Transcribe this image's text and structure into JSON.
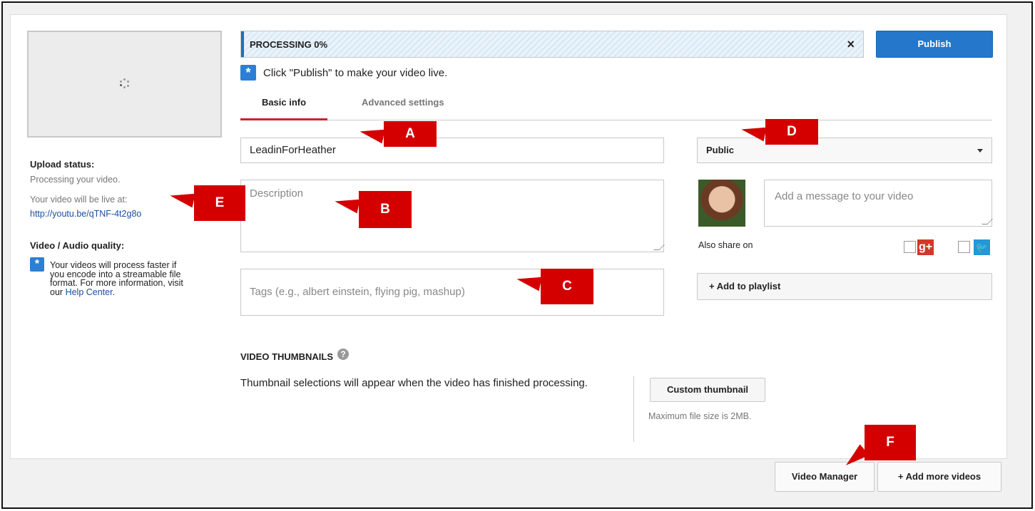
{
  "progress": {
    "label": "PROCESSING 0%",
    "value_percent": 0,
    "close_glyph": "×"
  },
  "publish_label": "Publish",
  "hint_text": "Click \"Publish\" to make your video live.",
  "tabs": [
    {
      "label": "Basic info",
      "active": true
    },
    {
      "label": "Advanced settings",
      "active": false
    }
  ],
  "form": {
    "title_value": "LeadinForHeather",
    "description_placeholder": "Description",
    "tags_placeholder": "Tags (e.g., albert einstein, flying pig, mashup)"
  },
  "privacy": {
    "selected": "Public"
  },
  "message_placeholder": "Add a message to your video",
  "share": {
    "label": "Also share on",
    "gplus_glyph": "g+",
    "twitter_glyph": "🐦"
  },
  "playlist_label": "+ Add to playlist",
  "sidebar": {
    "upload_status_heading": "Upload status:",
    "upload_status_text": "Processing your video.",
    "live_at_text": "Your video will be live at:",
    "video_url": "http://youtu.be/qTNF-4t2g8o",
    "quality_heading": "Video / Audio quality:",
    "quality_text": "Your videos will process faster if you encode into a streamable file format. For more information, visit our",
    "help_link": "Help Center",
    "help_period": "."
  },
  "thumbnails": {
    "heading": "VIDEO THUMBNAILS",
    "help_glyph": "?",
    "text": "Thumbnail selections will appear when the video has finished processing.",
    "custom_button": "Custom thumbnail",
    "max_size": "Maximum file size is 2MB."
  },
  "footer": {
    "video_manager": "Video Manager",
    "add_more": "+ Add more videos"
  },
  "callouts": {
    "a": "A",
    "b": "B",
    "c": "C",
    "d": "D",
    "e": "E",
    "f": "F"
  },
  "colors": {
    "publish_blue": "#2477cb",
    "tab_underline": "#c1272d",
    "callout_red": "#d40000",
    "link_blue": "#1b4fa0"
  }
}
